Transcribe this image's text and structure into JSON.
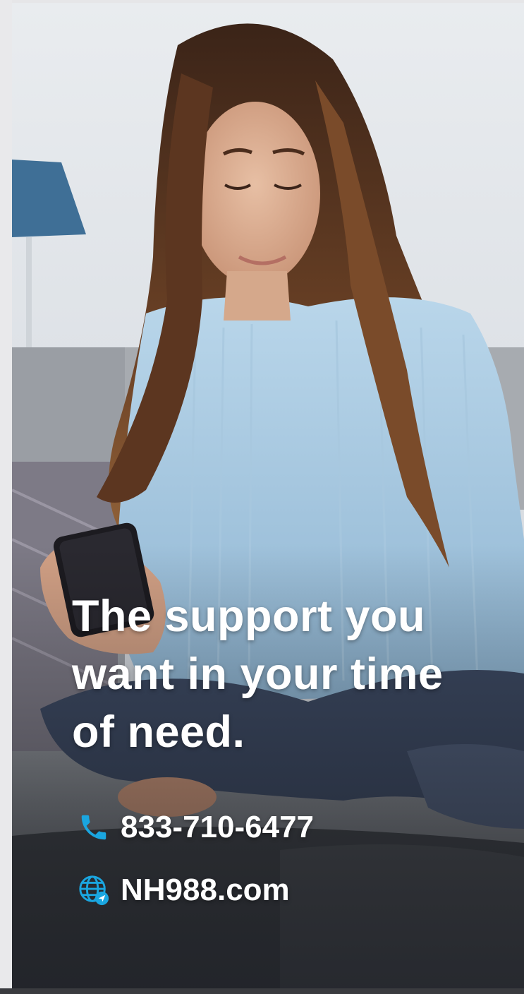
{
  "headline": {
    "lines": [
      "The support you",
      "want in your time",
      "of need."
    ]
  },
  "contacts": {
    "phone": {
      "icon": "phone-icon",
      "text": "833-710-6477"
    },
    "website": {
      "icon": "globe-icon",
      "text": "NH988.com"
    }
  },
  "colors": {
    "accent": "#1aa6e0",
    "headline_text": "#ffffff"
  }
}
